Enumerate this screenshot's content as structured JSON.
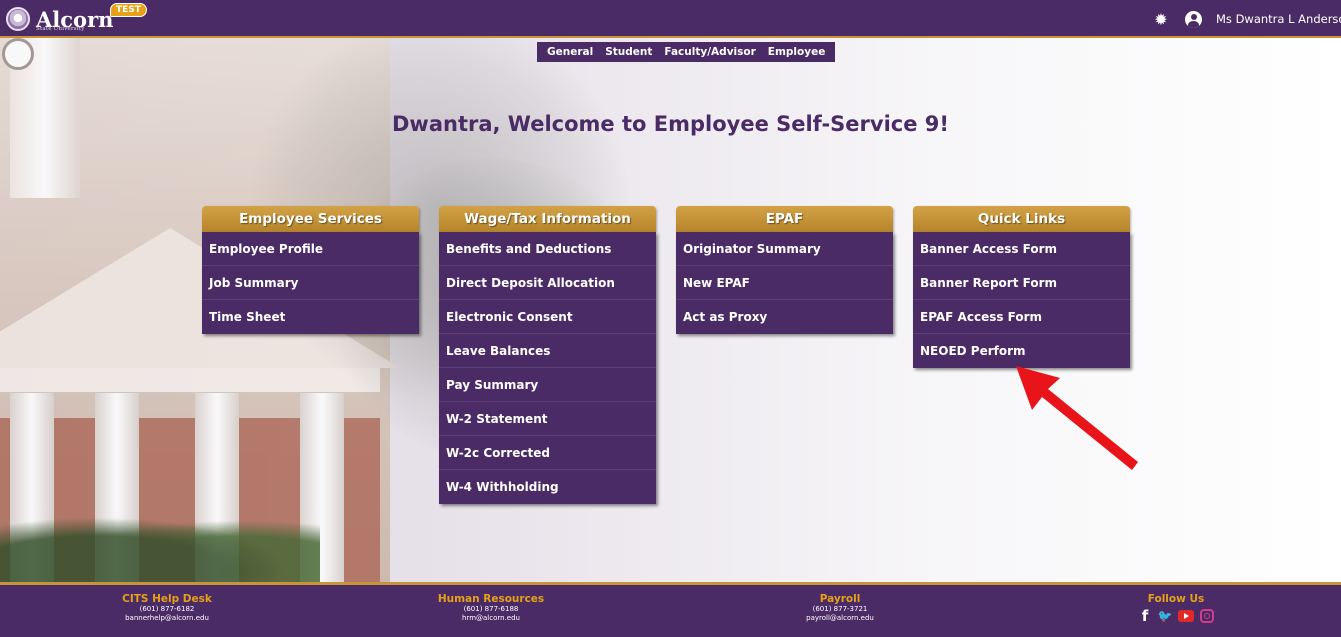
{
  "header": {
    "logo_text": "Alcorn",
    "logo_subtext": "State University",
    "test_badge": "TEST",
    "user_name": "Ms Dwantra L Anderson",
    "icons": [
      "gear-icon",
      "user-icon"
    ]
  },
  "nav": {
    "tabs": [
      "General",
      "Student",
      "Faculty/Advisor",
      "Employee"
    ]
  },
  "welcome": {
    "title": "Dwantra, Welcome to Employee Self-Service 9!"
  },
  "cards": [
    {
      "title": "Employee Services",
      "items": [
        "Employee Profile",
        "Job Summary",
        "Time Sheet"
      ]
    },
    {
      "title": "Wage/Tax Information",
      "items": [
        "Benefits and Deductions",
        "Direct Deposit Allocation",
        "Electronic Consent",
        "Leave Balances",
        "Pay Summary",
        "W-2 Statement",
        "W-2c Corrected",
        "W-4 Withholding"
      ]
    },
    {
      "title": "EPAF",
      "items": [
        "Originator Summary",
        "New EPAF",
        "Act as Proxy"
      ]
    },
    {
      "title": "Quick Links",
      "items": [
        "Banner Access Form",
        "Banner Report Form",
        "EPAF Access Form",
        "NEOED Perform"
      ]
    }
  ],
  "footer": {
    "cits": {
      "title": "CITS Help Desk",
      "phone": "(601) 877-6182",
      "email": "bannerhelp@alcorn.edu"
    },
    "hr": {
      "title": "Human Resources",
      "phone": "(601) 877-6188",
      "email": "hrm@alcorn.edu"
    },
    "payroll": {
      "title": "Payroll",
      "phone": "(601) 877-3721",
      "email": "payroll@alcorn.edu"
    },
    "follow": {
      "title": "Follow Us",
      "icons": [
        "facebook-icon",
        "twitter-icon",
        "youtube-icon",
        "instagram-icon"
      ]
    }
  },
  "colors": {
    "primary_purple": "#4b2b66",
    "gold": "#c9933a",
    "annotation_arrow": "#e8141a"
  }
}
